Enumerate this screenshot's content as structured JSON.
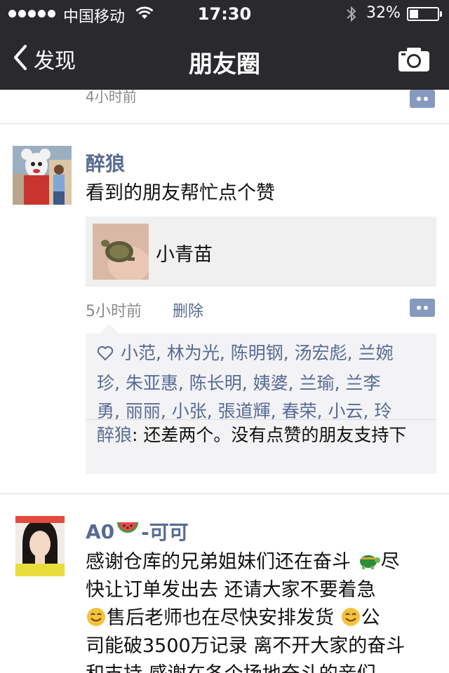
{
  "status_bar": {
    "carrier": "中国移动",
    "time": "17:30",
    "battery_percent": "32%",
    "battery_level": 0.32
  },
  "nav": {
    "back_label": "发现",
    "title": "朋友圈"
  },
  "feed": {
    "previous_post": {
      "time": "4小时前"
    },
    "posts": [
      {
        "author": "醉狼",
        "text": "看到的朋友帮忙点个赞",
        "share_title": "小青苗",
        "time": "5小时前",
        "delete_label": "删除",
        "likes_line1": "小范, 林为光, 陈明钢, 汤宏彪, 兰婉",
        "likes_line2": "珍, 朱亚惠, 陈长明, 姨婆, 兰瑜, 兰李",
        "likes_line3": "勇, 丽丽, 小张, 張道輝, 春荣, 小云, 玲",
        "comment_author": "醉狼",
        "comment_text": ": 还差两个。没有点赞的朋友支持下"
      },
      {
        "author_prefix": "A0",
        "author_suffix": "-可可",
        "text_line1": "感谢仓库的兄弟姐妹们还在奋斗 ",
        "text_line1b": "尽",
        "text_line2": "快让订单发出去 还请大家不要着急",
        "text_line3": "售后老师也在尽快安排发货 ",
        "text_line3b": "公",
        "text_line4": "司能破3500万记录 离不开大家的奋斗",
        "text_line5": "和支持 感谢在各个场地奋斗的亲们"
      }
    ]
  },
  "icons": {
    "back": "chevron-left-icon",
    "camera": "camera-icon",
    "more": "comment-more-icon",
    "heart": "heart-outline-icon",
    "watermelon": "watermelon-emoji",
    "turtle": "turtle-emoji",
    "smile": "smile-emoji"
  },
  "colors": {
    "nav_bg": "#2a2a2e",
    "link_blue": "#576b95"
  }
}
